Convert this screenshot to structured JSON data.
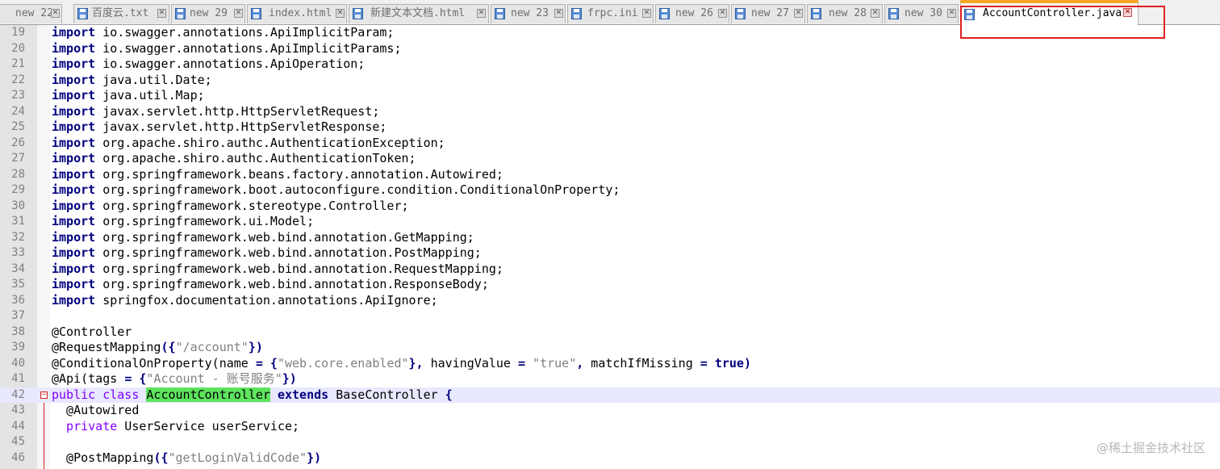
{
  "tabs": [
    {
      "label": "new 22",
      "active": false
    },
    {
      "label": "百度云.txt",
      "active": false
    },
    {
      "label": "new 29",
      "active": false
    },
    {
      "label": "index.html",
      "active": false
    },
    {
      "label": "新建文本文档.html",
      "active": false
    },
    {
      "label": "new 23",
      "active": false
    },
    {
      "label": "frpc.ini",
      "active": false
    },
    {
      "label": "new 26",
      "active": false
    },
    {
      "label": "new 27",
      "active": false
    },
    {
      "label": "new 28",
      "active": false
    },
    {
      "label": "new 30",
      "active": false
    },
    {
      "label": "AccountController.java",
      "active": true
    }
  ],
  "icons": {
    "file": "floppy-disk-icon",
    "close": "close-icon",
    "fold": "fold-minus-icon"
  },
  "colors": {
    "active_tab_accent": "#f5a623",
    "highlight_box": "#e02020",
    "keyword": "#000080",
    "string": "#808080",
    "selection": "#5ee35e",
    "current_line": "#e8e8ff"
  },
  "editor": {
    "lines": [
      {
        "num": "19",
        "kw": "import",
        "rest": " io.swagger.annotations.ApiImplicitParam;"
      },
      {
        "num": "20",
        "kw": "import",
        "rest": " io.swagger.annotations.ApiImplicitParams;"
      },
      {
        "num": "21",
        "kw": "import",
        "rest": " io.swagger.annotations.ApiOperation;"
      },
      {
        "num": "22",
        "kw": "import",
        "rest": " java.util.Date;"
      },
      {
        "num": "23",
        "kw": "import",
        "rest": " java.util.Map;"
      },
      {
        "num": "24",
        "kw": "import",
        "rest": " javax.servlet.http.HttpServletRequest;"
      },
      {
        "num": "25",
        "kw": "import",
        "rest": " javax.servlet.http.HttpServletResponse;"
      },
      {
        "num": "26",
        "kw": "import",
        "rest": " org.apache.shiro.authc.AuthenticationException;"
      },
      {
        "num": "27",
        "kw": "import",
        "rest": " org.apache.shiro.authc.AuthenticationToken;"
      },
      {
        "num": "28",
        "kw": "import",
        "rest": " org.springframework.beans.factory.annotation.Autowired;"
      },
      {
        "num": "29",
        "kw": "import",
        "rest": " org.springframework.boot.autoconfigure.condition.ConditionalOnProperty;"
      },
      {
        "num": "30",
        "kw": "import",
        "rest": " org.springframework.stereotype.Controller;"
      },
      {
        "num": "31",
        "kw": "import",
        "rest": " org.springframework.ui.Model;"
      },
      {
        "num": "32",
        "kw": "import",
        "rest": " org.springframework.web.bind.annotation.GetMapping;"
      },
      {
        "num": "33",
        "kw": "import",
        "rest": " org.springframework.web.bind.annotation.PostMapping;"
      },
      {
        "num": "34",
        "kw": "import",
        "rest": " org.springframework.web.bind.annotation.RequestMapping;"
      },
      {
        "num": "35",
        "kw": "import",
        "rest": " org.springframework.web.bind.annotation.ResponseBody;"
      },
      {
        "num": "36",
        "kw": "import",
        "rest": " springfox.documentation.annotations.ApiIgnore;"
      },
      {
        "num": "37"
      },
      {
        "num": "38",
        "plain": "@Controller"
      },
      {
        "num": "39",
        "a": "@RequestMapping",
        "b": "({",
        "s": "\"/account\"",
        "c": "})"
      },
      {
        "num": "40",
        "a": "@ConditionalOnProperty(name ",
        "b": "= {",
        "s": "\"web.core.enabled\"",
        "c": "},",
        "d": " havingValue ",
        "e": "=",
        "f": " ",
        "s2": "\"true\"",
        "g": ",",
        "h": " matchIfMissing ",
        "i": "=",
        "j": " ",
        "k": "true",
        "l": ")"
      },
      {
        "num": "41",
        "a": "@Api(tags ",
        "b": "= {",
        "s": "\"Account - 账号服务\"",
        "c": "})"
      },
      {
        "num": "42",
        "k1": "public",
        "sp1": " ",
        "k2": "class",
        "sp2": " ",
        "sel": "AccountController",
        "sp3": " ",
        "k3": "extends",
        "rest": " BaseController ",
        "brace": "{"
      },
      {
        "num": "43",
        "plain": "  @Autowired"
      },
      {
        "num": "44",
        "k1": "  private",
        "rest": " UserService userService;"
      },
      {
        "num": "45"
      },
      {
        "num": "46",
        "a": "  @PostMapping",
        "b": "({",
        "s": "\"getLoginValidCode\"",
        "c": "})"
      }
    ]
  },
  "watermark": "@稀土掘金技术社区"
}
